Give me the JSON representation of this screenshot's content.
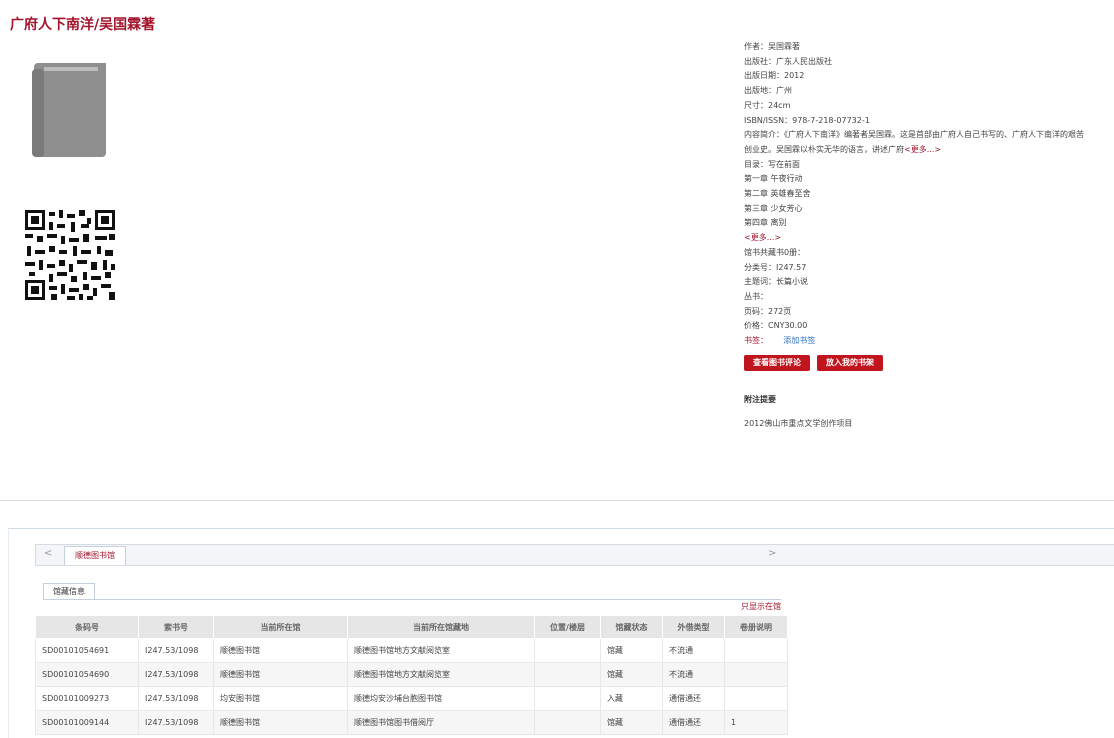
{
  "book": {
    "title": "广府人下南洋/吴国霖著"
  },
  "info": {
    "author": "作者：吴国霖著",
    "publisher": "出版社：广东人民出版社",
    "pub_date": "出版日期：2012",
    "pub_place": "出版地：广州",
    "size": "尺寸：24cm",
    "isbn": "ISBN/ISSN：978-7-218-07732-1",
    "summary_line1": "内容简介：《广府人下南洋》编著者吴国霖。这是首部由广府人自己书写的、广府人下南洋的艰苦",
    "summary_line2": "创业史。吴国霖以朴实无华的语言，讲述广府",
    "summary_more": "<更多...>",
    "toc_label": "目录：写在前面",
    "toc": [
      "第一章 午夜行动",
      "第二章 英雄春至舍",
      "第三章 少女芳心",
      "第四章 离别"
    ],
    "toc_more": "<更多...>",
    "copies": "馆书共藏书0册：",
    "class_no": "分类号：I247.57",
    "subject": "主题词：长篇小说",
    "series": "丛书：",
    "pages": "页码：272页",
    "price": "价格：CNY30.00",
    "tags_label": "书签：",
    "add_tag": "添加书签",
    "btn_review": "查看图书评论",
    "btn_shelf": "放入我的书架",
    "attach_title": "附注提要",
    "attach_text": "2012佛山市重点文学创作项目"
  },
  "holdings": {
    "library_tab": "顺德图书馆",
    "sub_tab": "馆藏信息",
    "only_show": "只显示在馆",
    "columns": [
      "条码号",
      "索书号",
      "当前所在馆",
      "当前所在馆藏地",
      "位置/楼层",
      "馆藏状态",
      "外借类型",
      "卷册说明"
    ],
    "rows": [
      [
        "SD00101054691",
        "I247.53/1098",
        "顺德图书馆",
        "顺德图书馆地方文献阅览室",
        "",
        "馆藏",
        "不流通",
        ""
      ],
      [
        "SD00101054690",
        "I247.53/1098",
        "顺德图书馆",
        "顺德图书馆地方文献阅览室",
        "",
        "馆藏",
        "不流通",
        ""
      ],
      [
        "SD00101009273",
        "I247.53/1098",
        "均安图书馆",
        "顺德均安沙埔台胞图书馆",
        "",
        "入藏",
        "通借通还",
        ""
      ],
      [
        "SD00101009144",
        "I247.53/1098",
        "顺德图书馆",
        "顺德图书馆图书借阅厅",
        "",
        "馆藏",
        "通借通还",
        "1"
      ]
    ]
  }
}
